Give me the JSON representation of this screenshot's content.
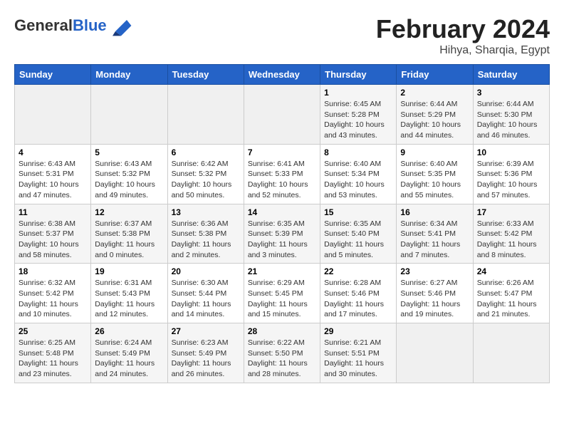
{
  "header": {
    "logo_general": "General",
    "logo_blue": "Blue",
    "month_title": "February 2024",
    "location": "Hihya, Sharqia, Egypt"
  },
  "days_of_week": [
    "Sunday",
    "Monday",
    "Tuesday",
    "Wednesday",
    "Thursday",
    "Friday",
    "Saturday"
  ],
  "weeks": [
    [
      {
        "day": "",
        "info": ""
      },
      {
        "day": "",
        "info": ""
      },
      {
        "day": "",
        "info": ""
      },
      {
        "day": "",
        "info": ""
      },
      {
        "day": "1",
        "info": "Sunrise: 6:45 AM\nSunset: 5:28 PM\nDaylight: 10 hours and 43 minutes."
      },
      {
        "day": "2",
        "info": "Sunrise: 6:44 AM\nSunset: 5:29 PM\nDaylight: 10 hours and 44 minutes."
      },
      {
        "day": "3",
        "info": "Sunrise: 6:44 AM\nSunset: 5:30 PM\nDaylight: 10 hours and 46 minutes."
      }
    ],
    [
      {
        "day": "4",
        "info": "Sunrise: 6:43 AM\nSunset: 5:31 PM\nDaylight: 10 hours and 47 minutes."
      },
      {
        "day": "5",
        "info": "Sunrise: 6:43 AM\nSunset: 5:32 PM\nDaylight: 10 hours and 49 minutes."
      },
      {
        "day": "6",
        "info": "Sunrise: 6:42 AM\nSunset: 5:32 PM\nDaylight: 10 hours and 50 minutes."
      },
      {
        "day": "7",
        "info": "Sunrise: 6:41 AM\nSunset: 5:33 PM\nDaylight: 10 hours and 52 minutes."
      },
      {
        "day": "8",
        "info": "Sunrise: 6:40 AM\nSunset: 5:34 PM\nDaylight: 10 hours and 53 minutes."
      },
      {
        "day": "9",
        "info": "Sunrise: 6:40 AM\nSunset: 5:35 PM\nDaylight: 10 hours and 55 minutes."
      },
      {
        "day": "10",
        "info": "Sunrise: 6:39 AM\nSunset: 5:36 PM\nDaylight: 10 hours and 57 minutes."
      }
    ],
    [
      {
        "day": "11",
        "info": "Sunrise: 6:38 AM\nSunset: 5:37 PM\nDaylight: 10 hours and 58 minutes."
      },
      {
        "day": "12",
        "info": "Sunrise: 6:37 AM\nSunset: 5:38 PM\nDaylight: 11 hours and 0 minutes."
      },
      {
        "day": "13",
        "info": "Sunrise: 6:36 AM\nSunset: 5:38 PM\nDaylight: 11 hours and 2 minutes."
      },
      {
        "day": "14",
        "info": "Sunrise: 6:35 AM\nSunset: 5:39 PM\nDaylight: 11 hours and 3 minutes."
      },
      {
        "day": "15",
        "info": "Sunrise: 6:35 AM\nSunset: 5:40 PM\nDaylight: 11 hours and 5 minutes."
      },
      {
        "day": "16",
        "info": "Sunrise: 6:34 AM\nSunset: 5:41 PM\nDaylight: 11 hours and 7 minutes."
      },
      {
        "day": "17",
        "info": "Sunrise: 6:33 AM\nSunset: 5:42 PM\nDaylight: 11 hours and 8 minutes."
      }
    ],
    [
      {
        "day": "18",
        "info": "Sunrise: 6:32 AM\nSunset: 5:42 PM\nDaylight: 11 hours and 10 minutes."
      },
      {
        "day": "19",
        "info": "Sunrise: 6:31 AM\nSunset: 5:43 PM\nDaylight: 11 hours and 12 minutes."
      },
      {
        "day": "20",
        "info": "Sunrise: 6:30 AM\nSunset: 5:44 PM\nDaylight: 11 hours and 14 minutes."
      },
      {
        "day": "21",
        "info": "Sunrise: 6:29 AM\nSunset: 5:45 PM\nDaylight: 11 hours and 15 minutes."
      },
      {
        "day": "22",
        "info": "Sunrise: 6:28 AM\nSunset: 5:46 PM\nDaylight: 11 hours and 17 minutes."
      },
      {
        "day": "23",
        "info": "Sunrise: 6:27 AM\nSunset: 5:46 PM\nDaylight: 11 hours and 19 minutes."
      },
      {
        "day": "24",
        "info": "Sunrise: 6:26 AM\nSunset: 5:47 PM\nDaylight: 11 hours and 21 minutes."
      }
    ],
    [
      {
        "day": "25",
        "info": "Sunrise: 6:25 AM\nSunset: 5:48 PM\nDaylight: 11 hours and 23 minutes."
      },
      {
        "day": "26",
        "info": "Sunrise: 6:24 AM\nSunset: 5:49 PM\nDaylight: 11 hours and 24 minutes."
      },
      {
        "day": "27",
        "info": "Sunrise: 6:23 AM\nSunset: 5:49 PM\nDaylight: 11 hours and 26 minutes."
      },
      {
        "day": "28",
        "info": "Sunrise: 6:22 AM\nSunset: 5:50 PM\nDaylight: 11 hours and 28 minutes."
      },
      {
        "day": "29",
        "info": "Sunrise: 6:21 AM\nSunset: 5:51 PM\nDaylight: 11 hours and 30 minutes."
      },
      {
        "day": "",
        "info": ""
      },
      {
        "day": "",
        "info": ""
      }
    ]
  ]
}
